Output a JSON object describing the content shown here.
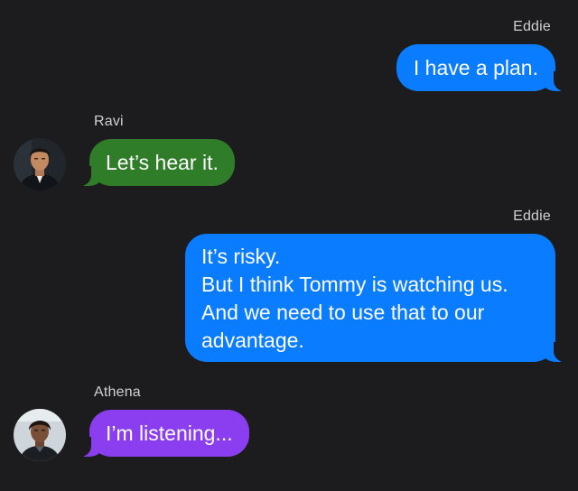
{
  "thread": {
    "messages": [
      {
        "sender": "Eddie",
        "direction": "outgoing",
        "text": "I have a plan."
      },
      {
        "sender": "Ravi",
        "direction": "incoming",
        "text": "Let’s hear it.",
        "bubble_color": "#2f7d28"
      },
      {
        "sender": "Eddie",
        "direction": "outgoing",
        "text": "It’s risky.\nBut I think Tommy is watching us.\nAnd we need to use that to our\nadvantage."
      },
      {
        "sender": "Athena",
        "direction": "incoming",
        "text": "I’m listening...",
        "bubble_color": "#8a3ef0"
      }
    ]
  },
  "colors": {
    "background": "#1c1c1e",
    "outgoing_bubble": "#0a7cff",
    "sender_label": "#d0d0d4"
  }
}
